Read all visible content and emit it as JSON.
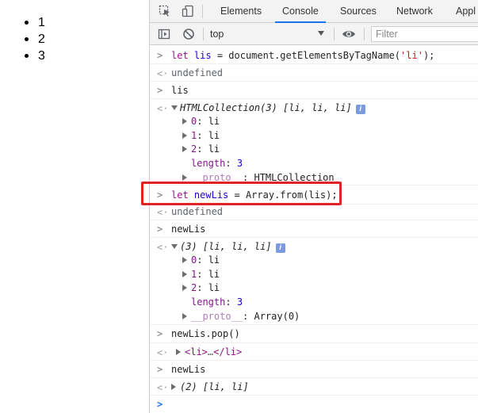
{
  "page": {
    "list_items": [
      "1",
      "2",
      "3"
    ]
  },
  "devtools": {
    "tabs": [
      "Elements",
      "Console",
      "Sources",
      "Network",
      "Appl"
    ],
    "active_tab": "Console",
    "toolbar": {
      "context_label": "top",
      "filter_placeholder": "Filter"
    },
    "colors": {
      "accent": "#1a73e8",
      "highlight_border": "#e02424",
      "keyword": "#aa0d91",
      "string": "#c41a16"
    },
    "console": {
      "line1": {
        "kw": "let",
        "var": "lis",
        "mid": " = document.getElementsByTagName(",
        "str": "'li'",
        "end": ");"
      },
      "line2": "undefined",
      "line3": "lis",
      "line4": {
        "name": "HTMLCollection(3) [li, li, li]",
        "badge": "i"
      },
      "line5": {
        "key": "0",
        "val": "li"
      },
      "line6": {
        "key": "1",
        "val": "li"
      },
      "line7": {
        "key": "2",
        "val": "li"
      },
      "line8": {
        "key": "length",
        "val": "3"
      },
      "line9": {
        "key": "__proto__",
        "val": "HTMLCollection"
      },
      "line10": {
        "kw": "let",
        "var": "newLis",
        "rest": " = Array.from(lis);"
      },
      "line11": "undefined",
      "line12": "newLis",
      "line13": {
        "name": "(3) [li, li, li]",
        "badge": "i"
      },
      "line14": {
        "key": "0",
        "val": "li"
      },
      "line15": {
        "key": "1",
        "val": "li"
      },
      "line16": {
        "key": "2",
        "val": "li"
      },
      "line17": {
        "key": "length",
        "val": "3"
      },
      "line18": {
        "key": "__proto__",
        "val": "Array(0)"
      },
      "line19": "newLis.pop()",
      "line20": {
        "open": "<li>",
        "ellipsis": "…",
        "close": "</li>"
      },
      "line21": "newLis",
      "line22": "(2) [li, li]"
    }
  }
}
